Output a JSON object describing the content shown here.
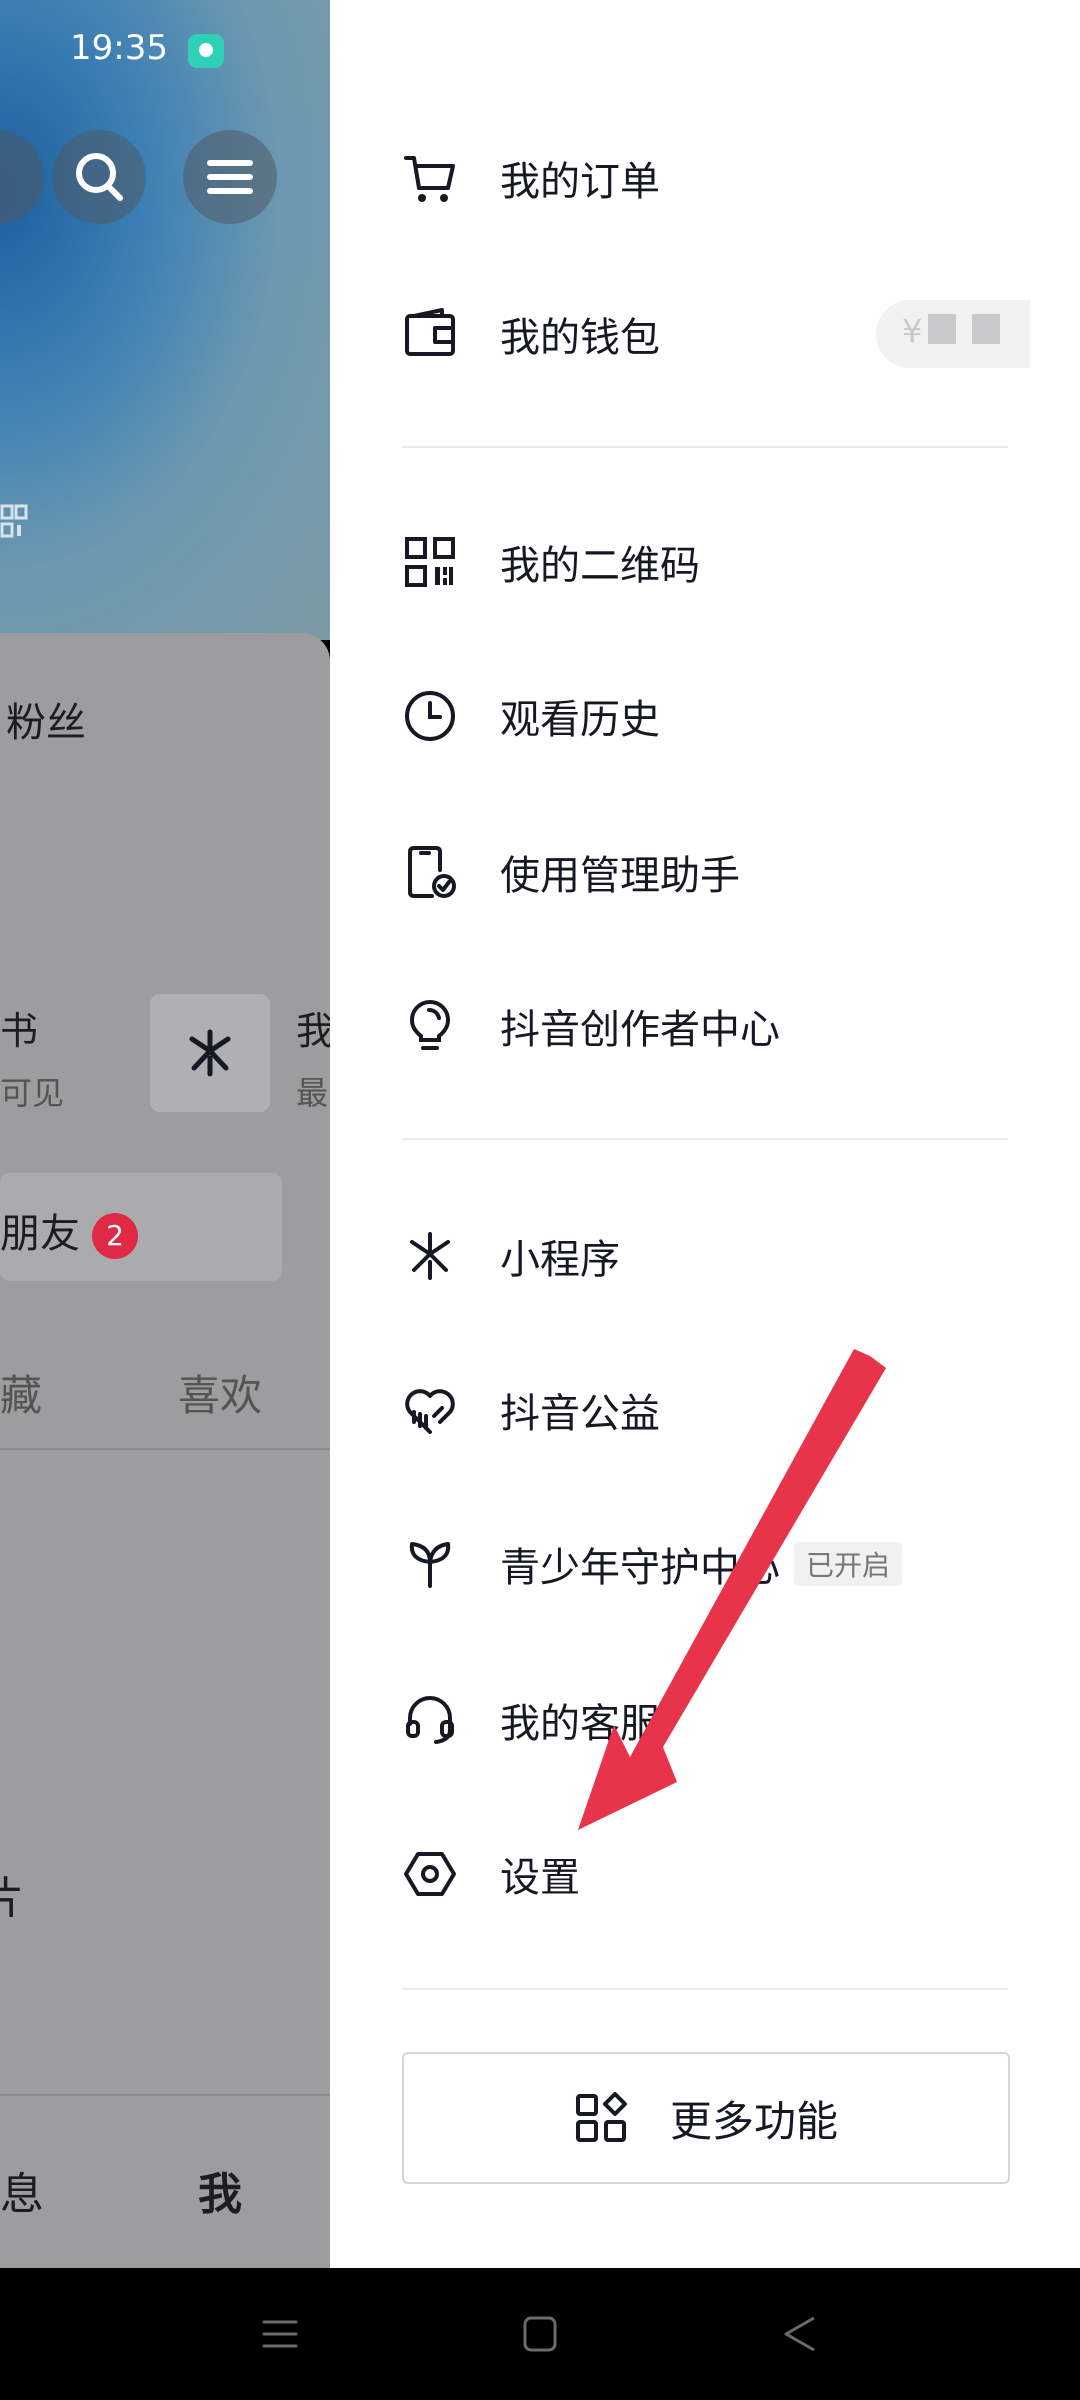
{
  "status_bar": {
    "time": "19:35"
  },
  "background": {
    "fans_label": "粉丝",
    "card_left_title": "书",
    "card_left_sub": "可见",
    "card_right_title": "我",
    "card_right_sub": "最",
    "friends_label": "朋友",
    "friends_badge": "2",
    "tab_collect": "藏",
    "tab_like": "喜欢",
    "partial_text": "片",
    "nav_message": "息",
    "nav_me": "我"
  },
  "drawer": {
    "items": [
      {
        "label": "我的订单",
        "icon": "cart-icon"
      },
      {
        "label": "我的钱包",
        "icon": "wallet-icon",
        "badge": "¥"
      },
      {
        "label": "我的二维码",
        "icon": "qrcode-icon"
      },
      {
        "label": "观看历史",
        "icon": "clock-icon"
      },
      {
        "label": "使用管理助手",
        "icon": "phone-check-icon"
      },
      {
        "label": "抖音创作者中心",
        "icon": "lightbulb-icon"
      },
      {
        "label": "小程序",
        "icon": "mini-program-icon"
      },
      {
        "label": "抖音公益",
        "icon": "charity-heart-icon"
      },
      {
        "label": "青少年守护中心",
        "icon": "sprout-icon",
        "tag": "已开启"
      },
      {
        "label": "我的客服",
        "icon": "headset-icon"
      },
      {
        "label": "设置",
        "icon": "settings-hexagon-icon"
      }
    ],
    "more_button": {
      "label": "更多功能",
      "icon": "apps-icon"
    }
  },
  "annotation": {
    "icon": "red-arrow-icon",
    "color": "#e8344a"
  },
  "nav_bar": {
    "icons": [
      "menu-icon",
      "home-square-icon",
      "back-triangle-icon"
    ]
  }
}
